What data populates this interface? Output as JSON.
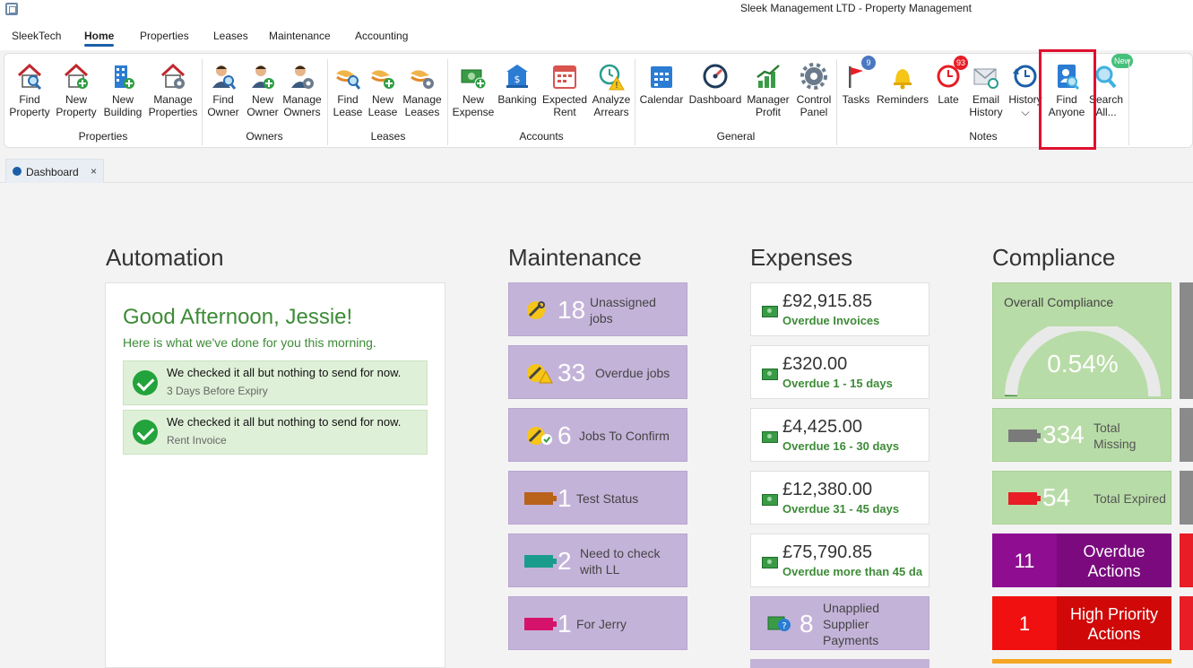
{
  "window": {
    "title": "Sleek Management LTD - Property Management"
  },
  "menu": {
    "items": [
      "SleekTech",
      "Home",
      "Properties",
      "Leases",
      "Maintenance",
      "Accounting"
    ],
    "active_index": 1
  },
  "ribbon": {
    "groups": [
      {
        "label": "Properties",
        "buttons": [
          {
            "line1": "Find",
            "line2": "Property",
            "icon": "find-property-icon"
          },
          {
            "line1": "New",
            "line2": "Property",
            "icon": "new-property-icon"
          },
          {
            "line1": "New",
            "line2": "Building",
            "icon": "new-building-icon"
          },
          {
            "line1": "Manage",
            "line2": "Properties",
            "icon": "manage-properties-icon"
          }
        ]
      },
      {
        "label": "Owners",
        "buttons": [
          {
            "line1": "Find",
            "line2": "Owner",
            "icon": "find-owner-icon"
          },
          {
            "line1": "New",
            "line2": "Owner",
            "icon": "new-owner-icon"
          },
          {
            "line1": "Manage",
            "line2": "Owners",
            "icon": "manage-owners-icon"
          }
        ]
      },
      {
        "label": "Leases",
        "buttons": [
          {
            "line1": "Find",
            "line2": "Lease",
            "icon": "find-lease-icon"
          },
          {
            "line1": "New",
            "line2": "Lease",
            "icon": "new-lease-icon"
          },
          {
            "line1": "Manage",
            "line2": "Leases",
            "icon": "manage-leases-icon"
          }
        ]
      },
      {
        "label": "Accounts",
        "buttons": [
          {
            "line1": "New",
            "line2": "Expense",
            "icon": "new-expense-icon"
          },
          {
            "line1": "Banking",
            "line2": "",
            "icon": "banking-icon"
          },
          {
            "line1": "Expected",
            "line2": "Rent",
            "icon": "calendar-rent-icon"
          },
          {
            "line1": "Analyze",
            "line2": "Arrears",
            "icon": "analyze-arrears-icon"
          }
        ]
      },
      {
        "label": "General",
        "buttons": [
          {
            "line1": "Calendar",
            "line2": "",
            "icon": "calendar-icon"
          },
          {
            "line1": "Dashboard",
            "line2": "",
            "icon": "dashboard-gauge-icon"
          },
          {
            "line1": "Manager",
            "line2": "Profit",
            "icon": "manager-profit-icon"
          },
          {
            "line1": "Control",
            "line2": "Panel",
            "icon": "gear-icon"
          }
        ]
      },
      {
        "label": "Notes",
        "buttons": [
          {
            "line1": "Tasks",
            "line2": "",
            "icon": "flag-icon",
            "badge": "9"
          },
          {
            "line1": "Reminders",
            "line2": "",
            "icon": "bell-icon"
          },
          {
            "line1": "Late",
            "line2": "",
            "icon": "clock-icon",
            "badge": "93"
          },
          {
            "line1": "Email",
            "line2": "History",
            "icon": "email-icon"
          },
          {
            "line1": "History",
            "line2": "⌵",
            "icon": "history-icon"
          }
        ]
      }
    ],
    "extra_buttons": [
      {
        "line1": "Find",
        "line2": "Anyone",
        "icon": "find-anyone-icon"
      },
      {
        "line1": "Search",
        "line2": "All...",
        "icon": "search-all-icon",
        "badge": "New"
      }
    ]
  },
  "tabs": [
    {
      "label": "Dashboard",
      "close": "×"
    }
  ],
  "automation": {
    "title": "Automation",
    "greeting": "Good Afternoon, Jessie!",
    "subtitle": "Here is what we've done for you this morning.",
    "items": [
      {
        "main": "We checked it all but nothing to send for now.",
        "sub": "3 Days Before Expiry"
      },
      {
        "main": "We checked it all but nothing to send for now.",
        "sub": "Rent Invoice"
      }
    ]
  },
  "maintenance": {
    "title": "Maintenance",
    "tiles": [
      {
        "num": "18",
        "label1": "Unassigned",
        "label2": "jobs",
        "icon": "wrench-icon"
      },
      {
        "num": "33",
        "label1": "Overdue jobs",
        "label2": "",
        "icon": "wrench-warning-icon"
      },
      {
        "num": "6",
        "label1": "Jobs To Confirm",
        "label2": "",
        "icon": "wrench-check-icon"
      },
      {
        "num": "1",
        "label1": "Test Status",
        "label2": "",
        "icon": "status-plug-icon",
        "color": "#b8621a"
      },
      {
        "num": "2",
        "label1": "Need to check",
        "label2": "with LL",
        "icon": "status-plug-icon",
        "color": "#1a9c8c"
      },
      {
        "num": "1",
        "label1": "For Jerry",
        "label2": "",
        "icon": "status-plug-icon",
        "color": "#d6136b"
      }
    ]
  },
  "expenses": {
    "title": "Expenses",
    "tiles": [
      {
        "amount": "£92,915.85",
        "label": "Overdue Invoices"
      },
      {
        "amount": "£320.00",
        "label": "Overdue 1 - 15 days"
      },
      {
        "amount": "£4,425.00",
        "label": "Overdue 16 - 30 days"
      },
      {
        "amount": "£12,380.00",
        "label": "Overdue 31 - 45 days"
      },
      {
        "amount": "£75,790.85",
        "label": "Overdue more than 45 da"
      }
    ],
    "unapplied": {
      "num": "8",
      "label1": "Unapplied",
      "label2": "Supplier",
      "label3": "Payments"
    }
  },
  "compliance": {
    "title": "Compliance",
    "overall": {
      "label": "Overall Compliance",
      "value": "0.54%",
      "fraction": 0.0054
    },
    "tiles": [
      {
        "num": "334",
        "label1": "Total",
        "label2": "Missing",
        "color": "#7a7a7a"
      },
      {
        "num": "54",
        "label1": "Total Expired",
        "label2": "",
        "color": "#e81d25"
      }
    ],
    "actions": [
      {
        "num": "11",
        "label1": "Overdue",
        "label2": "Actions",
        "color": "#8e0d91",
        "dark": "#7a0a7d"
      },
      {
        "num": "1",
        "label1": "High Priority",
        "label2": "Actions",
        "color": "#f01010",
        "dark": "#d00808"
      }
    ]
  },
  "colors": {
    "accent": "#1a5fa8",
    "highlight": "#e0102e",
    "maint_tile": "#c4b3d9",
    "compliance_tile": "#b8dca7",
    "green_text": "#3d8b37"
  }
}
